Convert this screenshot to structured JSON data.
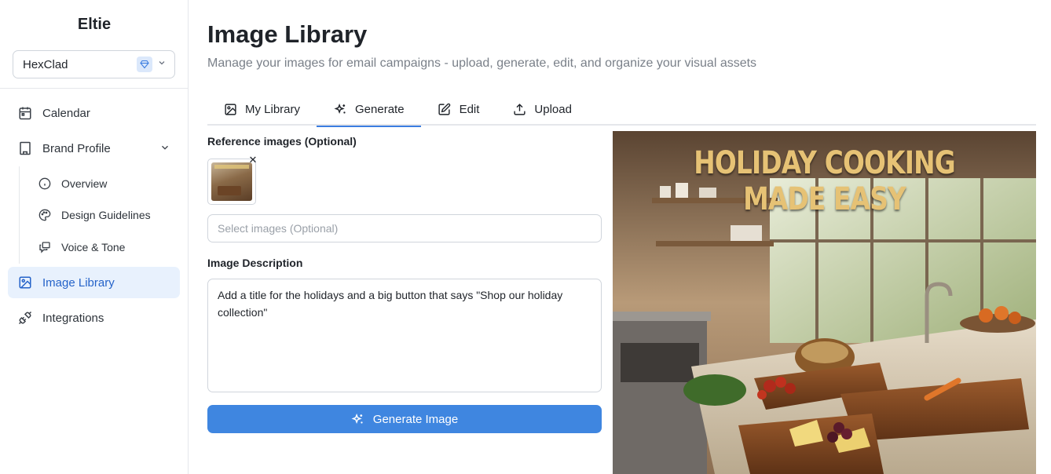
{
  "app": {
    "title": "Eltie"
  },
  "brand_selector": {
    "value": "HexClad"
  },
  "sidebar": {
    "items": [
      {
        "label": "Calendar",
        "icon": "calendar-icon"
      },
      {
        "label": "Brand Profile",
        "icon": "building-icon"
      },
      {
        "label": "Image Library",
        "icon": "image-icon",
        "active": true
      },
      {
        "label": "Integrations",
        "icon": "plug-icon"
      }
    ],
    "sub_items": [
      {
        "label": "Overview",
        "icon": "info-icon"
      },
      {
        "label": "Design Guidelines",
        "icon": "palette-icon"
      },
      {
        "label": "Voice & Tone",
        "icon": "message-icon"
      }
    ]
  },
  "page": {
    "title": "Image Library",
    "subtitle": "Manage your images for email campaigns - upload, generate, edit, and organize your visual assets"
  },
  "tabs": [
    {
      "label": "My Library",
      "icon": "image-icon"
    },
    {
      "label": "Generate",
      "icon": "sparkles-icon",
      "active": true
    },
    {
      "label": "Edit",
      "icon": "edit-icon"
    },
    {
      "label": "Upload",
      "icon": "upload-icon"
    }
  ],
  "generate_form": {
    "reference_label": "Reference images (Optional)",
    "select_placeholder": "Select images (Optional)",
    "description_label": "Image Description",
    "description_value": "Add a title for the holidays and a big button that says \"Shop our holiday collection\"",
    "button_label": "Generate Image"
  },
  "preview": {
    "title_text": "HOLIDAY COOKING MADE EASY"
  },
  "colors": {
    "accent": "#3f86e0",
    "active_nav_bg": "#e8f1fd",
    "active_nav_text": "#2563c9",
    "preview_title": "#e6c275"
  }
}
